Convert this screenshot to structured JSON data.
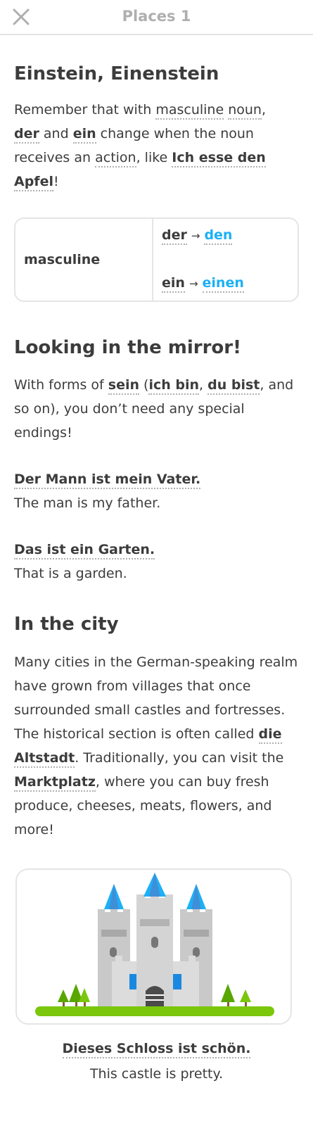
{
  "header": {
    "title": "Places 1",
    "close_icon": "close-icon"
  },
  "section1": {
    "title": "Einstein, Einenstein",
    "p": {
      "t1": "Remember that with ",
      "masculine": "masculine",
      "noun": "noun",
      "t2": ",",
      "der": "der",
      "t3": " and ",
      "ein": "ein",
      "t4": " change when the noun receives an ",
      "action": "action",
      "t5": ", like ",
      "example": "Ich esse den Apfel",
      "t6": "!"
    },
    "table": {
      "label": "masculine",
      "row1_from": "der",
      "row1_to": "den",
      "row2_from": "ein",
      "row2_to": "einen",
      "arrow": "→"
    }
  },
  "section2": {
    "title": "Looking in the mirror!",
    "p": {
      "t1": "With forms of ",
      "sein": "sein",
      "t2": " (",
      "ichbin": "ich bin",
      "t3": ", ",
      "dubist": "du bist",
      "t4": ", and so on), you don’t need any special endings!"
    },
    "ex1_de": "Der Mann ist mein Vater.",
    "ex1_en": "The man is my father.",
    "ex2_de": "Das ist ein Garten.",
    "ex2_en": "That is a garden."
  },
  "section3": {
    "title": "In the city",
    "p": {
      "t1": "Many cities in the German-speaking realm have grown from villages that once surrounded small castles and fortresses. The historical section is often called ",
      "altstadt": "die Altstadt",
      "t2": ". Traditionally, you can visit the ",
      "markt": "Marktplatz",
      "t3": ", where you can buy fresh produce, cheeses, meats, flowers, and more!"
    },
    "image_icon": "castle-icon",
    "caption_de": "Dieses Schloss ist schön.",
    "caption_en": "This castle is pretty."
  }
}
